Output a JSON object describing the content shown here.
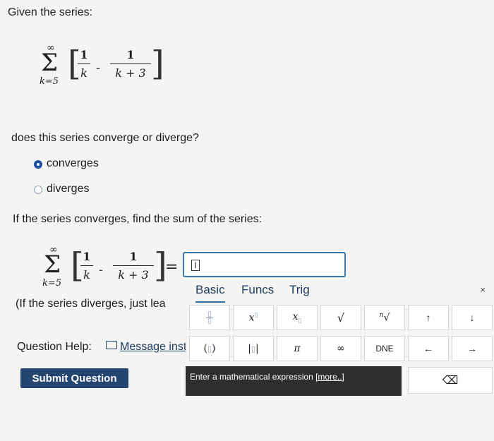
{
  "question": {
    "intro": "Given the series:",
    "series": {
      "upper": "∞",
      "lower": "k=5",
      "term1_num": "1",
      "term1_den": "k",
      "term2_num": "1",
      "term2_den": "k + 3"
    },
    "prompt": "does this series converge or diverge?",
    "options": [
      {
        "label": "converges",
        "selected": true
      },
      {
        "label": "diverges",
        "selected": false
      }
    ],
    "sum_prompt": "If the series converges, find the sum of the series:",
    "equals": "=",
    "diverge_note": "(If the series diverges, just lea",
    "help_label": "Question Help:",
    "message_link": "Message inst",
    "submit_label": "Submit Question"
  },
  "palette": {
    "tabs": [
      "Basic",
      "Funcs",
      "Trig"
    ],
    "close": "×",
    "row1": [
      "▫/▫",
      "x▫",
      "x▫",
      "√",
      "ⁿ√",
      "↑",
      "↓"
    ],
    "row2": [
      "(▫)",
      "|▫|",
      "π",
      "∞",
      "DNE",
      "←",
      "→"
    ],
    "help_text": "Enter a mathematical expression",
    "help_more": "[more..]",
    "backspace": "⌫"
  },
  "colors": {
    "accent": "#1b4fa8",
    "submit_bg": "#23456f",
    "help_bg": "#2e2e2e",
    "box_border": "#3c78a8"
  }
}
